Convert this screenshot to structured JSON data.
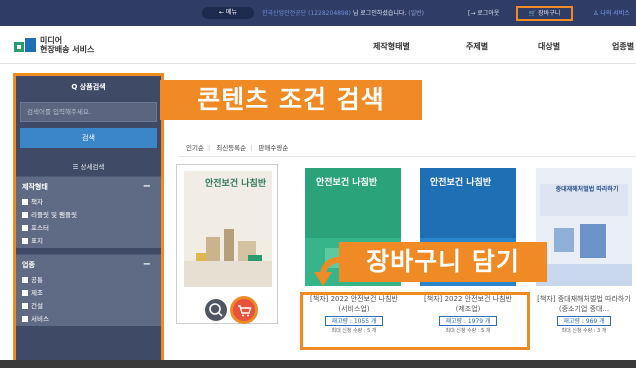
{
  "topbar": {
    "menu_label": "← 메뉴",
    "welcome_org": "한국산업안전공단 (1228204898)",
    "welcome_text": "님 로그인하셨습니다.",
    "welcome_role": "(일반)",
    "logout_label": "[→ 로그아웃",
    "cart_label": "장바구니",
    "mypage_label": "나의 서비스"
  },
  "header": {
    "logo_line1": "미디어",
    "logo_line2": "현장배송 서비스",
    "nav": [
      "제작형태별",
      "주제별",
      "대상별",
      "업종별"
    ]
  },
  "sidebar": {
    "title": "Q 상품검색",
    "search_placeholder": "검색어를 입력해주세요.",
    "search_button": "검색",
    "detail_title": "☰ 상세검색",
    "facets": [
      {
        "label": "제작형태",
        "options": [
          "책자",
          "리플릿 및 팸플릿",
          "포스터",
          "표지"
        ]
      },
      {
        "label": "업종",
        "options": [
          "공통",
          "제조",
          "건설",
          "서비스"
        ]
      }
    ]
  },
  "callouts": {
    "main": "콘텐츠 조건 검색",
    "cart": "장바구니 담기"
  },
  "sort": {
    "options": [
      "인기순",
      "최신등록순",
      "판매수량순"
    ]
  },
  "products": [
    {
      "title": "",
      "cover_title": "안전보건 나침반",
      "stock": "",
      "max": ""
    },
    {
      "title": "[책자] 2022 안전보건 나침반(서비스업)",
      "cover_title": "안전보건 나침반",
      "stock": "재고량 : 1055 개",
      "max": "최대 신청 수량 : 5 개"
    },
    {
      "title": "[책자] 2022 안전보건 나침반(제조업)",
      "cover_title": "안전보건 나침반",
      "stock": "재고량 : 1979 개",
      "max": "최대 신청 수량 : 5 개"
    },
    {
      "title": "[책자] 중대재해처벌법 따라하기(중소기업 중대...",
      "cover_title": "중대재해처벌법 따라하기",
      "stock": "재고량 : 969 개",
      "max": "최대 신청 수량 : 3 개"
    }
  ],
  "colors": {
    "accent": "#f08a24",
    "sidebar_bg": "#3f4a66",
    "search_button": "#3a86c9",
    "stock_blue": "#2f6fb7",
    "cover_green": "#2aa37a",
    "cover_blue": "#1f6fb5"
  },
  "icons": {
    "search_action": "search-icon",
    "cart_action": "cart-icon",
    "arrow": "curved-arrow-icon"
  }
}
